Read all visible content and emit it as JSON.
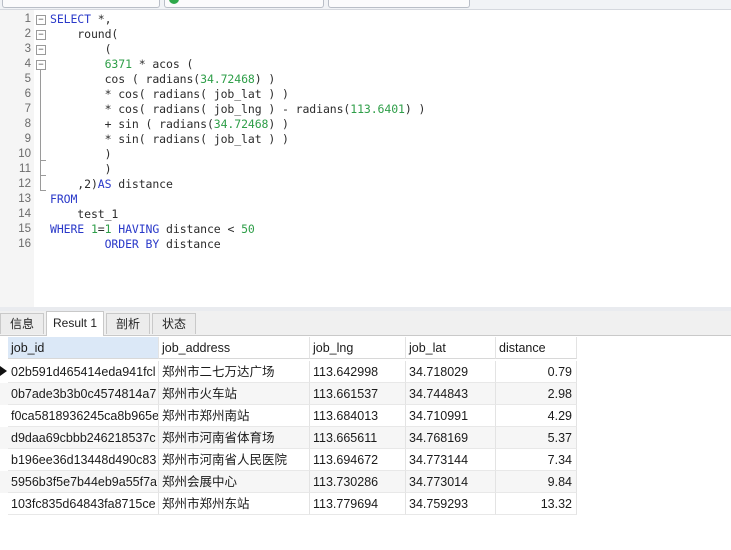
{
  "editor": {
    "lines": [
      {
        "n": "1",
        "code": [
          {
            "t": "SELECT",
            "c": "kw"
          },
          {
            "t": " *,",
            "c": ""
          }
        ]
      },
      {
        "n": "2",
        "code": [
          {
            "t": "    round(",
            "c": ""
          }
        ]
      },
      {
        "n": "3",
        "code": [
          {
            "t": "        (",
            "c": ""
          }
        ]
      },
      {
        "n": "4",
        "code": [
          {
            "t": "        ",
            "c": ""
          },
          {
            "t": "6371",
            "c": "num"
          },
          {
            "t": " * acos (",
            "c": ""
          }
        ]
      },
      {
        "n": "5",
        "code": [
          {
            "t": "        cos ( radians(",
            "c": ""
          },
          {
            "t": "34.72468",
            "c": "num"
          },
          {
            "t": ") )",
            "c": ""
          }
        ]
      },
      {
        "n": "6",
        "code": [
          {
            "t": "        * cos( radians( job_lat ) )",
            "c": ""
          }
        ]
      },
      {
        "n": "7",
        "code": [
          {
            "t": "        * cos( radians( job_lng ) - radians(",
            "c": ""
          },
          {
            "t": "113.6401",
            "c": "num"
          },
          {
            "t": ") )",
            "c": ""
          }
        ]
      },
      {
        "n": "8",
        "code": [
          {
            "t": "        + sin ( radians(",
            "c": ""
          },
          {
            "t": "34.72468",
            "c": "num"
          },
          {
            "t": ") )",
            "c": ""
          }
        ]
      },
      {
        "n": "9",
        "code": [
          {
            "t": "        * sin( radians( job_lat ) )",
            "c": ""
          }
        ]
      },
      {
        "n": "10",
        "code": [
          {
            "t": "        )",
            "c": ""
          }
        ]
      },
      {
        "n": "11",
        "code": [
          {
            "t": "        )",
            "c": ""
          }
        ]
      },
      {
        "n": "12",
        "code": [
          {
            "t": "    ,2)",
            "c": ""
          },
          {
            "t": "AS",
            "c": "kw"
          },
          {
            "t": " distance",
            "c": ""
          }
        ]
      },
      {
        "n": "13",
        "code": [
          {
            "t": "FROM",
            "c": "kw"
          }
        ]
      },
      {
        "n": "14",
        "code": [
          {
            "t": "    test_1",
            "c": ""
          }
        ]
      },
      {
        "n": "15",
        "code": [
          {
            "t": "WHERE",
            "c": "kw"
          },
          {
            "t": " ",
            "c": ""
          },
          {
            "t": "1",
            "c": "num"
          },
          {
            "t": "=",
            "c": ""
          },
          {
            "t": "1",
            "c": "num"
          },
          {
            "t": " ",
            "c": ""
          },
          {
            "t": "HAVING",
            "c": "kw"
          },
          {
            "t": " distance < ",
            "c": ""
          },
          {
            "t": "50",
            "c": "num"
          }
        ]
      },
      {
        "n": "16",
        "code": [
          {
            "t": "        ",
            "c": ""
          },
          {
            "t": "ORDER BY",
            "c": "kw"
          },
          {
            "t": " distance",
            "c": ""
          }
        ]
      }
    ]
  },
  "tabs": [
    {
      "label": "信息",
      "active": false
    },
    {
      "label": "Result 1",
      "active": true
    },
    {
      "label": "剖析",
      "active": false
    },
    {
      "label": "状态",
      "active": false
    }
  ],
  "grid": {
    "columns": [
      "job_id",
      "job_address",
      "job_lng",
      "job_lat",
      "distance"
    ],
    "rows": [
      [
        "02b591d465414eda941fcl",
        "郑州市二七万达广场",
        "113.642998",
        "34.718029",
        "0.79"
      ],
      [
        "0b7ade3b3b0c4574814a7",
        "郑州市火车站",
        "113.661537",
        "34.744843",
        "2.98"
      ],
      [
        "f0ca5818936245ca8b965e",
        "郑州市郑州南站",
        "113.684013",
        "34.710991",
        "4.29"
      ],
      [
        "d9daa69cbbb246218537c",
        "郑州市河南省体育场",
        "113.665611",
        "34.768169",
        "5.37"
      ],
      [
        "b196ee36d13448d490c83",
        "郑州市河南省人民医院",
        "113.694672",
        "34.773144",
        "7.34"
      ],
      [
        "5956b3f5e7b44eb9a55f7a",
        "郑州会展中心",
        "113.730286",
        "34.773014",
        "9.84"
      ],
      [
        "103fc835d64843fa8715ce",
        "郑州市郑州东站",
        "113.779694",
        "34.759293",
        "13.32"
      ]
    ]
  }
}
